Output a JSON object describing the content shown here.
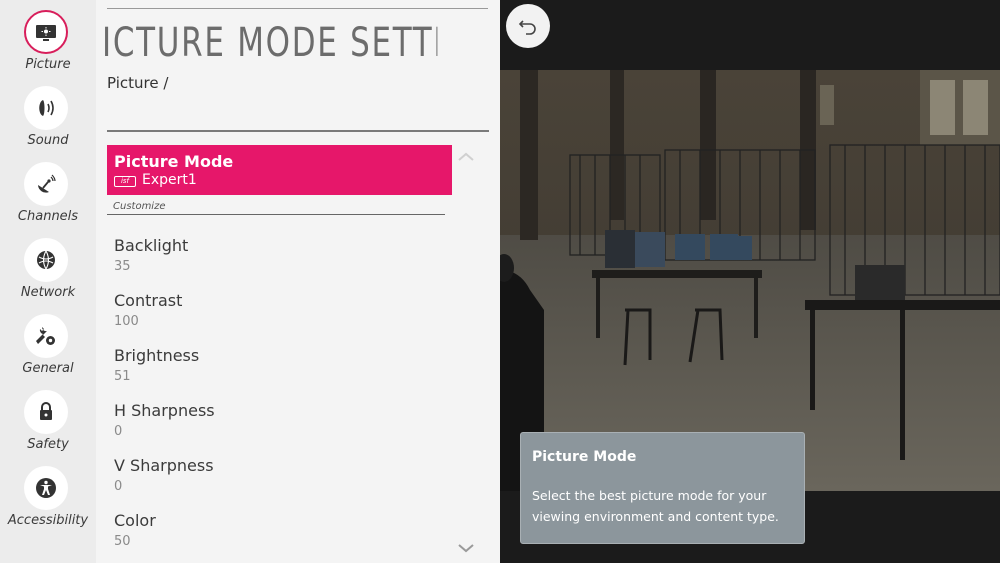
{
  "sidebar": {
    "items": [
      {
        "label": "Picture",
        "icon": "picture-icon",
        "active": true
      },
      {
        "label": "Sound",
        "icon": "sound-icon",
        "active": false
      },
      {
        "label": "Channels",
        "icon": "channels-icon",
        "active": false
      },
      {
        "label": "Network",
        "icon": "network-icon",
        "active": false
      },
      {
        "label": "General",
        "icon": "general-icon",
        "active": false
      },
      {
        "label": "Safety",
        "icon": "safety-icon",
        "active": false
      },
      {
        "label": "Accessibility",
        "icon": "accessibility-icon",
        "active": false
      }
    ]
  },
  "header": {
    "title": "ICTURE MODE SETTING",
    "breadcrumb": "Picture /"
  },
  "picture_mode": {
    "label": "Picture Mode",
    "badge": "isf",
    "value": "Expert1"
  },
  "section": {
    "label": "Customize"
  },
  "settings": [
    {
      "label": "Backlight",
      "value": "35"
    },
    {
      "label": "Contrast",
      "value": "100"
    },
    {
      "label": "Brightness",
      "value": "51"
    },
    {
      "label": "H Sharpness",
      "value": "0"
    },
    {
      "label": "V Sharpness",
      "value": "0"
    },
    {
      "label": "Color",
      "value": "50"
    }
  ],
  "info": {
    "title": "Picture Mode",
    "text": "Select the best picture mode for your viewing environment and content type."
  },
  "colors": {
    "accent": "#e6176a",
    "panel": "#f4f4f4",
    "rail": "#ececec",
    "info_card": "#8c969c"
  }
}
